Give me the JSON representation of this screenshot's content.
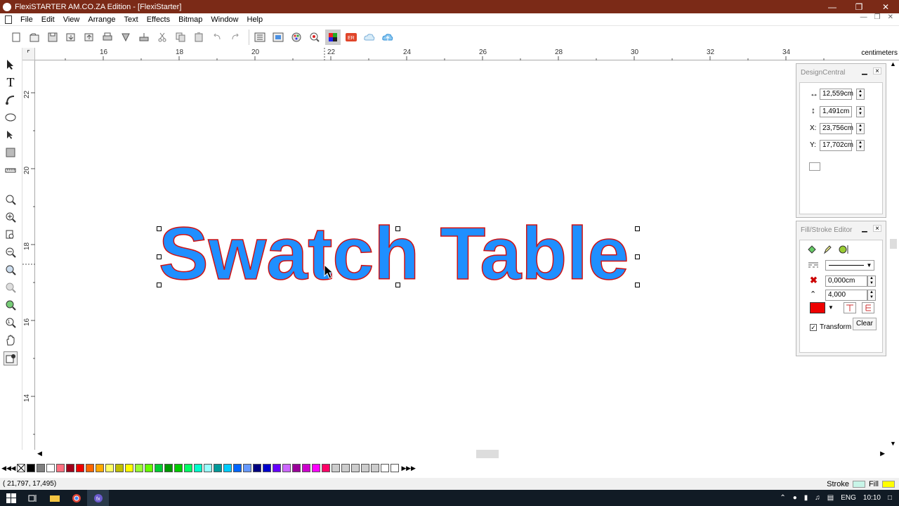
{
  "window": {
    "title": "FlexiSTARTER AM.CO.ZA Edition - [FlexiStarter]",
    "controls": [
      "minimize",
      "maximize",
      "close"
    ]
  },
  "menu": [
    "File",
    "Edit",
    "View",
    "Arrange",
    "Text",
    "Effects",
    "Bitmap",
    "Window",
    "Help"
  ],
  "ruler": {
    "unit": "centimeters",
    "top_labels": [
      "16",
      "18",
      "20",
      "22",
      "24",
      "26",
      "28",
      "30",
      "32",
      "34"
    ],
    "left_labels": [
      "22",
      "20",
      "18",
      "16",
      "14"
    ]
  },
  "canvas": {
    "text": "Swatch Table",
    "fill_color": "#1f8fff",
    "stroke_color": "#d11111"
  },
  "design_central": {
    "title": "DesignCentral",
    "width": "12,559cm",
    "height": "1,491cm",
    "x_label": "X:",
    "x": "23,756cm",
    "y_label": "Y:",
    "y": "17,702cm"
  },
  "fill_stroke": {
    "title": "Fill/Stroke Editor",
    "stroke_width": "0,000cm",
    "miter": "4,000",
    "stroke_color": "#ee0000",
    "transform_label": "Transform",
    "transform_checked": true,
    "clear_label": "Clear"
  },
  "palette": [
    "#000000",
    "#7f7f7f",
    "#ffffff",
    "#ff6f7f",
    "#a0001a",
    "#ee0000",
    "#ff6600",
    "#ffaa00",
    "#ffff66",
    "#bfbf00",
    "#ffff00",
    "#99ff33",
    "#66ff00",
    "#00cc33",
    "#009900",
    "#00cc00",
    "#00ff66",
    "#00ffcc",
    "#99ffff",
    "#009999",
    "#00ccff",
    "#0066ff",
    "#6699ff",
    "#000080",
    "#0000cc",
    "#6600ff",
    "#cc66ff",
    "#990099",
    "#cc00cc",
    "#ff00ff",
    "#ff0066"
  ],
  "status": {
    "coords": "( 21,797,   17,495)",
    "stroke_label": "Stroke",
    "fill_label": "Fill",
    "stroke_swatch": "#c8f5e8",
    "fill_swatch": "#ffff00"
  },
  "taskbar": {
    "lang": "ENG",
    "time": "10:10"
  }
}
